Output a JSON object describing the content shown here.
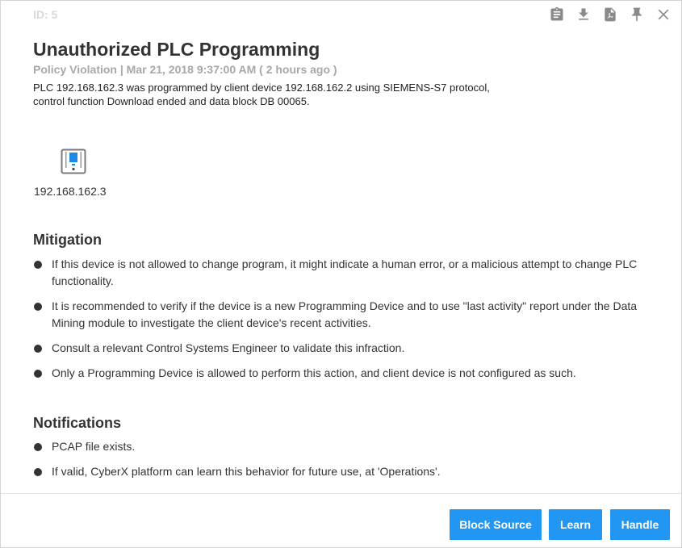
{
  "alert": {
    "id_label": "ID: 5",
    "title": "Unauthorized PLC Programming",
    "subtitle": "Policy Violation | Mar 21, 2018 9:37:00 AM ( 2 hours ago )",
    "description": "PLC 192.168.162.3 was programmed by client device 192.168.162.2 using SIEMENS-S7 protocol, control function Download ended and data block DB 00065."
  },
  "toolbar": {
    "icons": [
      "clipboard-icon",
      "download-icon",
      "pdf-icon",
      "pin-icon",
      "close-icon"
    ]
  },
  "device": {
    "icon": "plc-device-icon",
    "label": "192.168.162.3"
  },
  "mitigation": {
    "title": "Mitigation",
    "items": [
      "If this device is not allowed to change program, it might indicate a human error, or a malicious attempt to change PLC functionality.",
      "It is recommended to verify if the device is a new Programming Device and to use \"last activity\" report under the Data Mining module to investigate the client device's recent activities.",
      "Consult a relevant Control Systems Engineer to validate this infraction.",
      "Only a Programming Device is allowed to perform this action, and client device is not configured as such."
    ]
  },
  "notifications": {
    "title": "Notifications",
    "items": [
      "PCAP file exists.",
      "If valid, CyberX platform can learn this behavior for future use, at 'Operations'."
    ]
  },
  "actions": {
    "block_source": "Block Source",
    "learn": "Learn",
    "handle": "Handle"
  },
  "colors": {
    "accent": "#2196f3",
    "device_icon": "#1e88e5",
    "toolbar_icon": "#8a8a8a"
  }
}
